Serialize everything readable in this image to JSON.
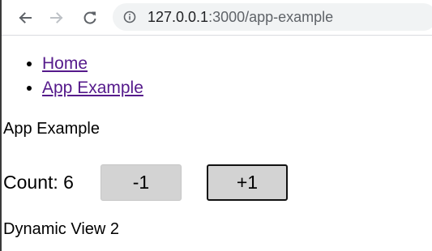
{
  "browser": {
    "url_host": "127.0.0.1",
    "url_path": ":3000/app-example"
  },
  "nav": {
    "items": [
      {
        "label": "Home"
      },
      {
        "label": "App Example"
      }
    ]
  },
  "app": {
    "title": "App Example",
    "count_label": "Count: 6",
    "decrement_label": "-1",
    "increment_label": "+1",
    "dynamic_view": "Dynamic View 2"
  },
  "icons": {
    "back": "arrow-left-icon",
    "forward": "arrow-right-icon",
    "reload": "reload-icon",
    "info": "info-icon"
  },
  "colors": {
    "link": "#551a8b",
    "button_bg": "#d3d3d3",
    "omnibox_bg": "#f1f3f4",
    "icon_active": "#5f6368",
    "icon_disabled": "#bdc1c6"
  }
}
